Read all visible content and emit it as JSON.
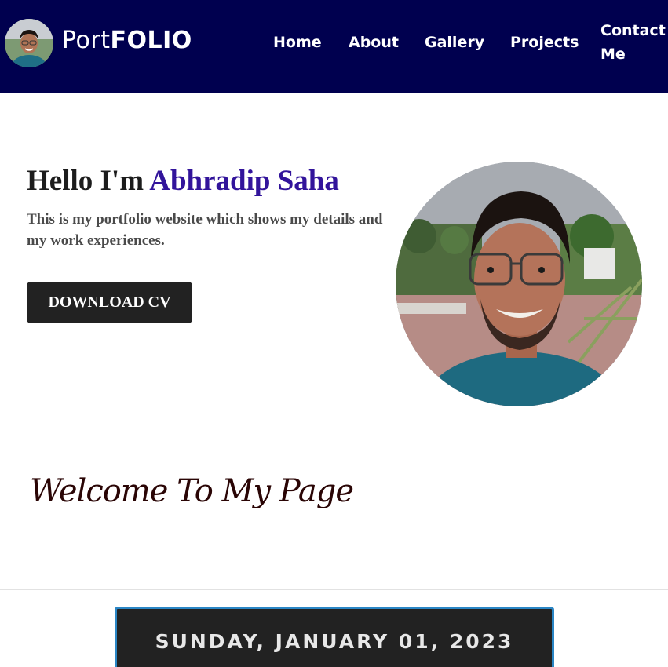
{
  "header": {
    "logo": {
      "prefix": "Port",
      "suffix": "FOLIO",
      "avatar_icon": "person-avatar"
    },
    "nav": {
      "home": "Home",
      "about": "About",
      "gallery": "Gallery",
      "projects": "Projects",
      "contact_line1": "Contact",
      "contact_line2": "Me"
    },
    "background_color": "#00004f"
  },
  "hero": {
    "greeting": "Hello I'm",
    "name": "Abhradip Saha",
    "name_color": "#32149b",
    "description": "This is my portfolio website which shows my details and my work experiences.",
    "cv_button": "DOWNLOAD CV",
    "photo_icon": "profile-photo"
  },
  "welcome": {
    "text": "Welcome To My Page"
  },
  "date_banner": {
    "text": "SUNDAY, JANUARY 01, 2023",
    "border_color": "#2b86c5"
  }
}
